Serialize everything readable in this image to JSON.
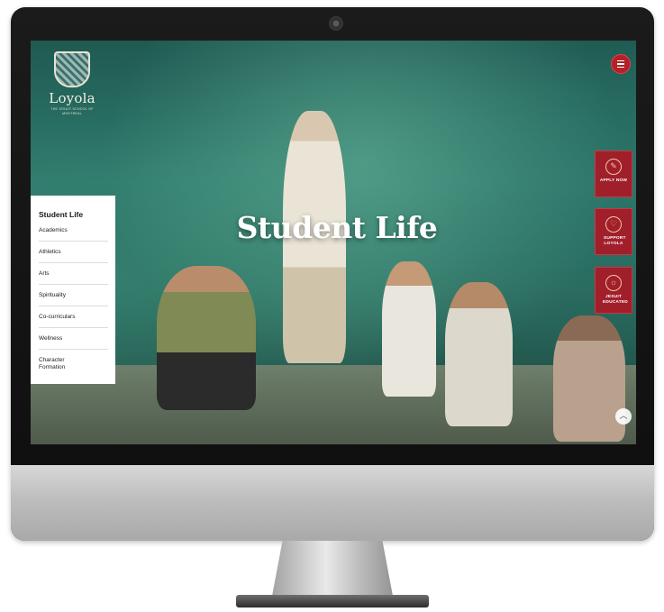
{
  "site": {
    "logo_name": "Loyola",
    "logo_subtitle": "THE JESUIT SCHOOL OF MONTREAL"
  },
  "hero": {
    "title": "Student Life"
  },
  "side_nav": {
    "active": "Student Life",
    "items": [
      {
        "label": "Academics"
      },
      {
        "label": "Athletics"
      },
      {
        "label": "Arts"
      },
      {
        "label": "Spirituality"
      },
      {
        "label": "Co-curriculars"
      },
      {
        "label": "Wellness"
      },
      {
        "label": "Character Formation"
      }
    ]
  },
  "actions": [
    {
      "label": "APPLY NOW",
      "icon": "apply-icon"
    },
    {
      "label": "SUPPORT LOYOLA",
      "icon": "heart-icon"
    },
    {
      "label": "JESUIT EDUCATED",
      "icon": "sun-icon"
    }
  ],
  "colors": {
    "accent_red": "#a11f2b",
    "nav_marker": "#c99a2e"
  }
}
